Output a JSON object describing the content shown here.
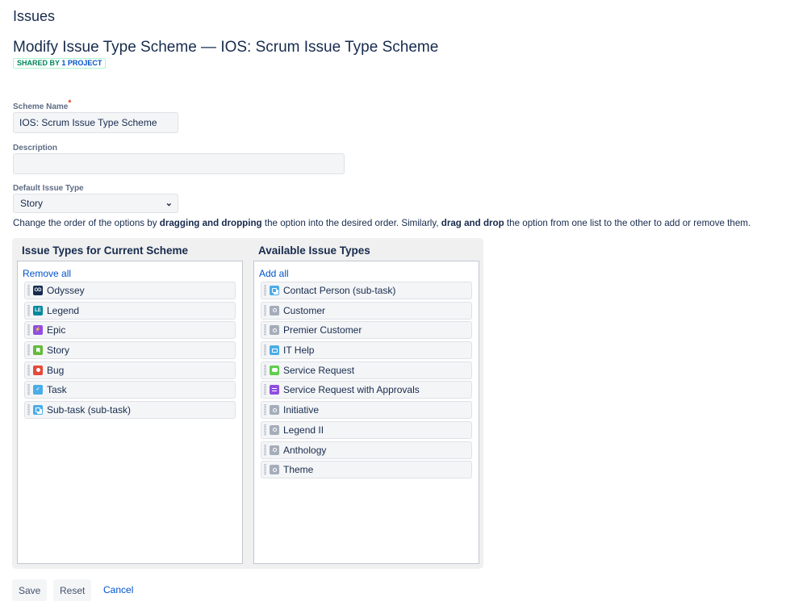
{
  "header": {
    "section_title": "Issues",
    "page_title": "Modify Issue Type Scheme — IOS: Scrum Issue Type Scheme",
    "shared_badge": {
      "prefix": "SHARED BY",
      "count_text": "1 PROJECT"
    }
  },
  "form": {
    "scheme_name": {
      "label": "Scheme Name",
      "required_marker": "*",
      "value": "IOS: Scrum Issue Type Scheme"
    },
    "description": {
      "label": "Description",
      "value": ""
    },
    "default_issue_type": {
      "label": "Default Issue Type",
      "selected": "Story"
    }
  },
  "instructions": {
    "part1": "Change the order of the options by ",
    "bold1": "dragging and dropping",
    "part2": " the option into the desired order. Similarly, ",
    "bold2": "drag and drop",
    "part3": " the option from one list to the other to add or remove them."
  },
  "current_list": {
    "title": "Issue Types for Current Scheme",
    "action": "Remove all",
    "items": [
      {
        "label": "Odyssey",
        "icon": "odyssey-icon",
        "icon_text": "OD",
        "color": "#172b4d"
      },
      {
        "label": "Legend",
        "icon": "legend-icon",
        "icon_text": "LE",
        "color": "#00889e"
      },
      {
        "label": "Epic",
        "icon": "epic-lightning-icon",
        "icon_text": "⚡",
        "color": "#904ee2"
      },
      {
        "label": "Story",
        "icon": "story-bookmark-icon",
        "icon_text": "",
        "color": "#63ba3c"
      },
      {
        "label": "Bug",
        "icon": "bug-icon",
        "icon_text": "",
        "color": "#e5493a"
      },
      {
        "label": "Task",
        "icon": "task-checkmark-icon",
        "icon_text": "✓",
        "color": "#4bade8"
      },
      {
        "label": "Sub-task (sub-task)",
        "icon": "subtask-icon",
        "icon_text": "",
        "color": "#4bade8"
      }
    ]
  },
  "available_list": {
    "title": "Available Issue Types",
    "action": "Add all",
    "items": [
      {
        "label": "Contact Person (sub-task)",
        "icon": "subtask-icon",
        "icon_text": "",
        "color": "#4bade8"
      },
      {
        "label": "Customer",
        "icon": "generic-issue-icon",
        "icon_text": "",
        "color": "#a5adba"
      },
      {
        "label": "Premier Customer",
        "icon": "generic-issue-icon",
        "icon_text": "",
        "color": "#a5adba"
      },
      {
        "label": "IT Help",
        "icon": "it-help-monitor-icon",
        "icon_text": "",
        "color": "#4bade8"
      },
      {
        "label": "Service Request",
        "icon": "service-request-chat-icon",
        "icon_text": "",
        "color": "#5fcf4c"
      },
      {
        "label": "Service Request with Approvals",
        "icon": "approvals-icon",
        "icon_text": "",
        "color": "#904ee2"
      },
      {
        "label": "Initiative",
        "icon": "generic-issue-icon",
        "icon_text": "",
        "color": "#a5adba"
      },
      {
        "label": "Legend II",
        "icon": "generic-issue-icon",
        "icon_text": "",
        "color": "#a5adba"
      },
      {
        "label": "Anthology",
        "icon": "generic-issue-icon",
        "icon_text": "",
        "color": "#a5adba"
      },
      {
        "label": "Theme",
        "icon": "generic-issue-icon",
        "icon_text": "",
        "color": "#a5adba"
      }
    ]
  },
  "footer": {
    "save_label": "Save",
    "reset_label": "Reset",
    "cancel_label": "Cancel"
  }
}
